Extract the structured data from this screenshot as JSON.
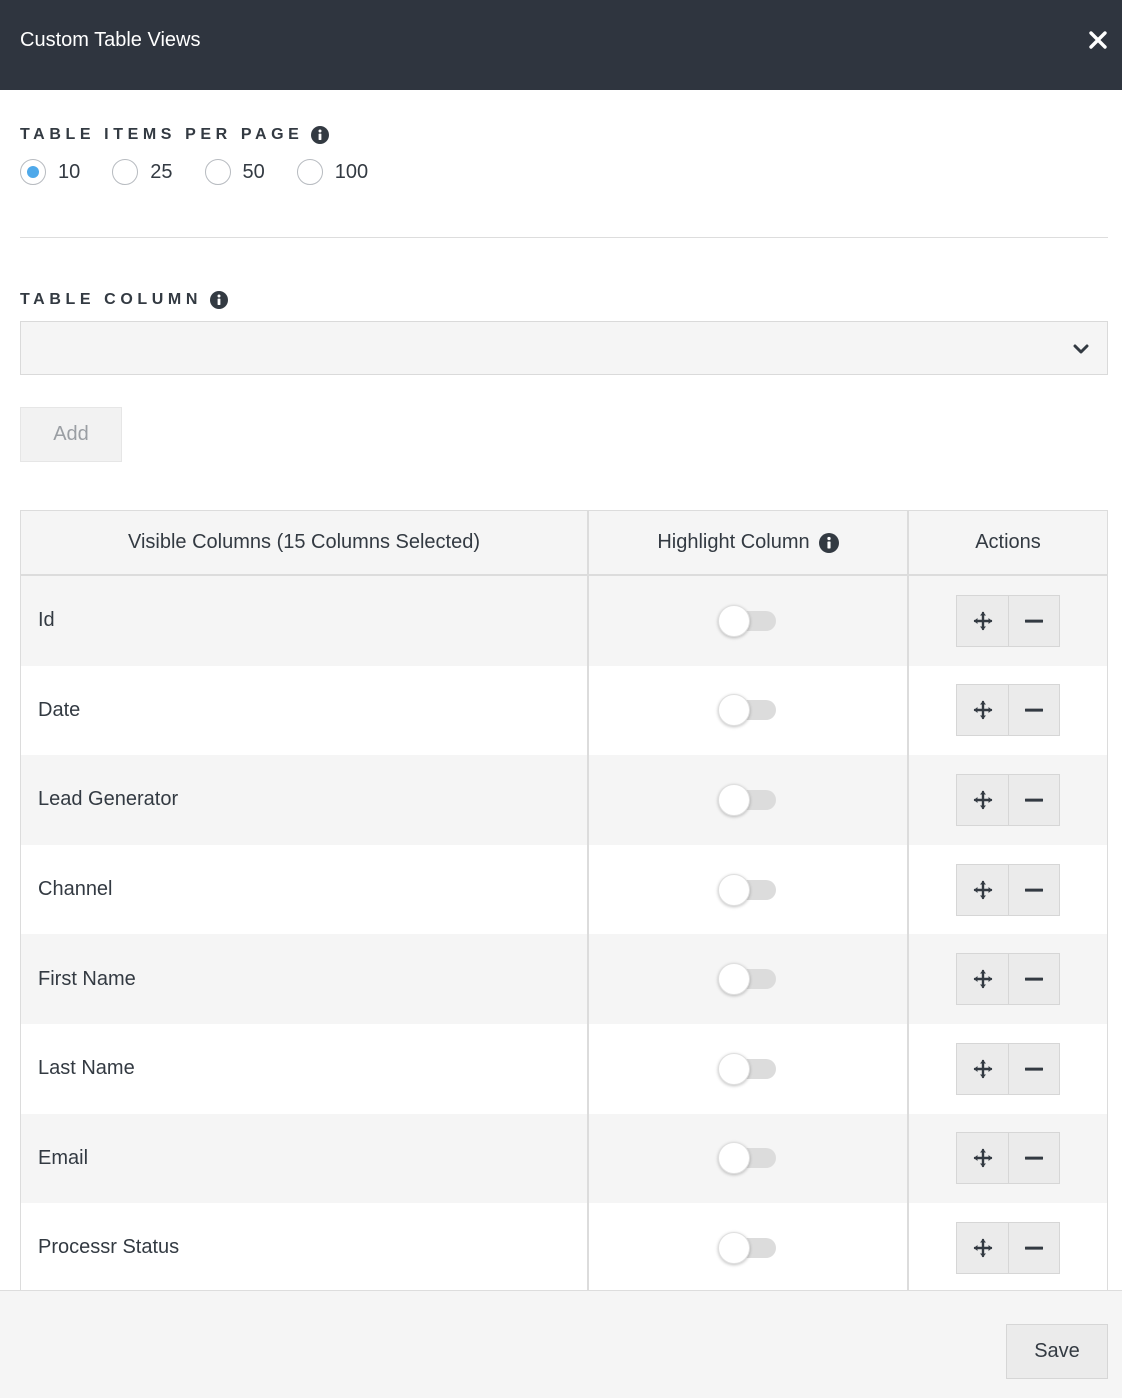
{
  "dialog": {
    "title": "Custom Table Views"
  },
  "items_per_page": {
    "label": "TABLE ITEMS PER PAGE",
    "options": [
      "10",
      "25",
      "50",
      "100"
    ],
    "selected": "10"
  },
  "table_column": {
    "label": "TABLE COLUMN",
    "selected_value": "",
    "add_label": "Add"
  },
  "columns_table": {
    "headers": {
      "visible": "Visible Columns (15 Columns Selected)",
      "highlight": "Highlight Column",
      "actions": "Actions"
    },
    "rows": [
      {
        "name": "Id",
        "highlighted": false
      },
      {
        "name": "Date",
        "highlighted": false
      },
      {
        "name": "Lead Generator",
        "highlighted": false
      },
      {
        "name": "Channel",
        "highlighted": false
      },
      {
        "name": "First Name",
        "highlighted": false
      },
      {
        "name": "Last Name",
        "highlighted": false
      },
      {
        "name": "Email",
        "highlighted": false
      },
      {
        "name": "Processr Status",
        "highlighted": false
      }
    ]
  },
  "footer": {
    "save_label": "Save"
  },
  "colors": {
    "header_bg": "#2f353f",
    "radio_accent": "#4fa9ea",
    "row_alt_bg": "#f5f5f5"
  },
  "icons": [
    "close-icon",
    "info-icon",
    "chevron-down-icon",
    "move-icon",
    "minus-icon"
  ]
}
